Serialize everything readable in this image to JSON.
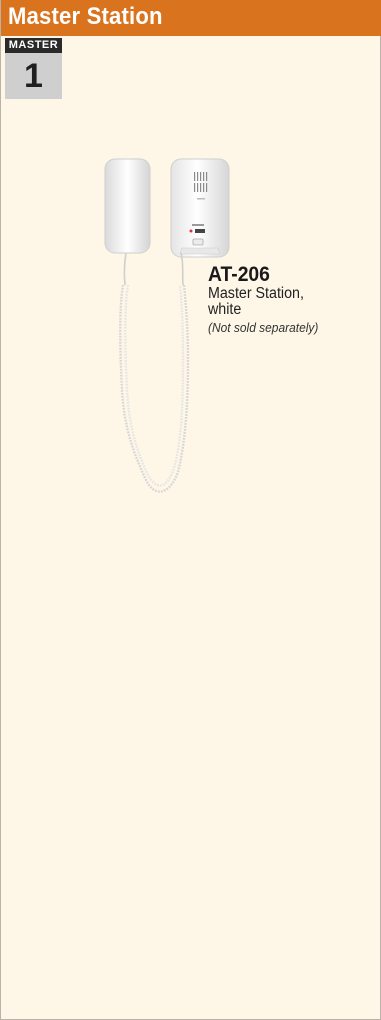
{
  "header": {
    "title": "Master Station"
  },
  "tag": {
    "label": "MASTER",
    "number": "1"
  },
  "product": {
    "model": "AT-206",
    "description_line1": "Master Station,",
    "description_line2": "white",
    "note": "(Not sold separately)"
  },
  "colors": {
    "header_bg": "#d9731e",
    "page_bg": "#fef6e7",
    "tag_dark": "#2a2a2a",
    "tag_light": "#cfcfcf"
  }
}
